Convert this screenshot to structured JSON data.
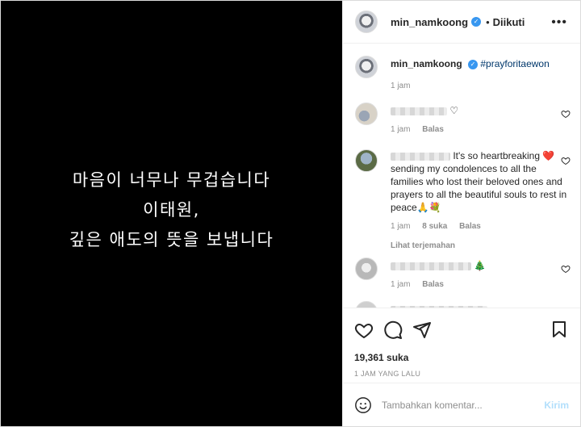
{
  "media": {
    "lines": [
      "마음이 너무나 무겁습니다",
      "이태원,",
      "깊은 애도의 뜻을 보냅니다"
    ]
  },
  "header": {
    "username": "min_namkoong",
    "separator": "•",
    "follow_label": "Diikuti",
    "more_label": "•••"
  },
  "caption": {
    "username": "min_namkoong",
    "hashtag": "#prayforitaewon",
    "time": "1 jam"
  },
  "comments": [
    {
      "text": "",
      "time": "1 jam",
      "likes": "",
      "reply": "Balas"
    },
    {
      "text": "It's so heartbreaking ❤️ sending my condolences to all the families who lost their beloved ones and prayers to all the beautiful souls to rest in peace🙏💐",
      "time": "1 jam",
      "likes": "8 suka",
      "reply": "Balas",
      "translate": "Lihat terjemahan"
    },
    {
      "text": "🎄",
      "time": "1 jam",
      "likes": "",
      "reply": "Balas"
    }
  ],
  "engagement": {
    "likes": "19,361 suka",
    "posted": "1 JAM YANG LALU"
  },
  "add_comment": {
    "placeholder": "Tambahkan komentar...",
    "send_label": "Kirim"
  }
}
